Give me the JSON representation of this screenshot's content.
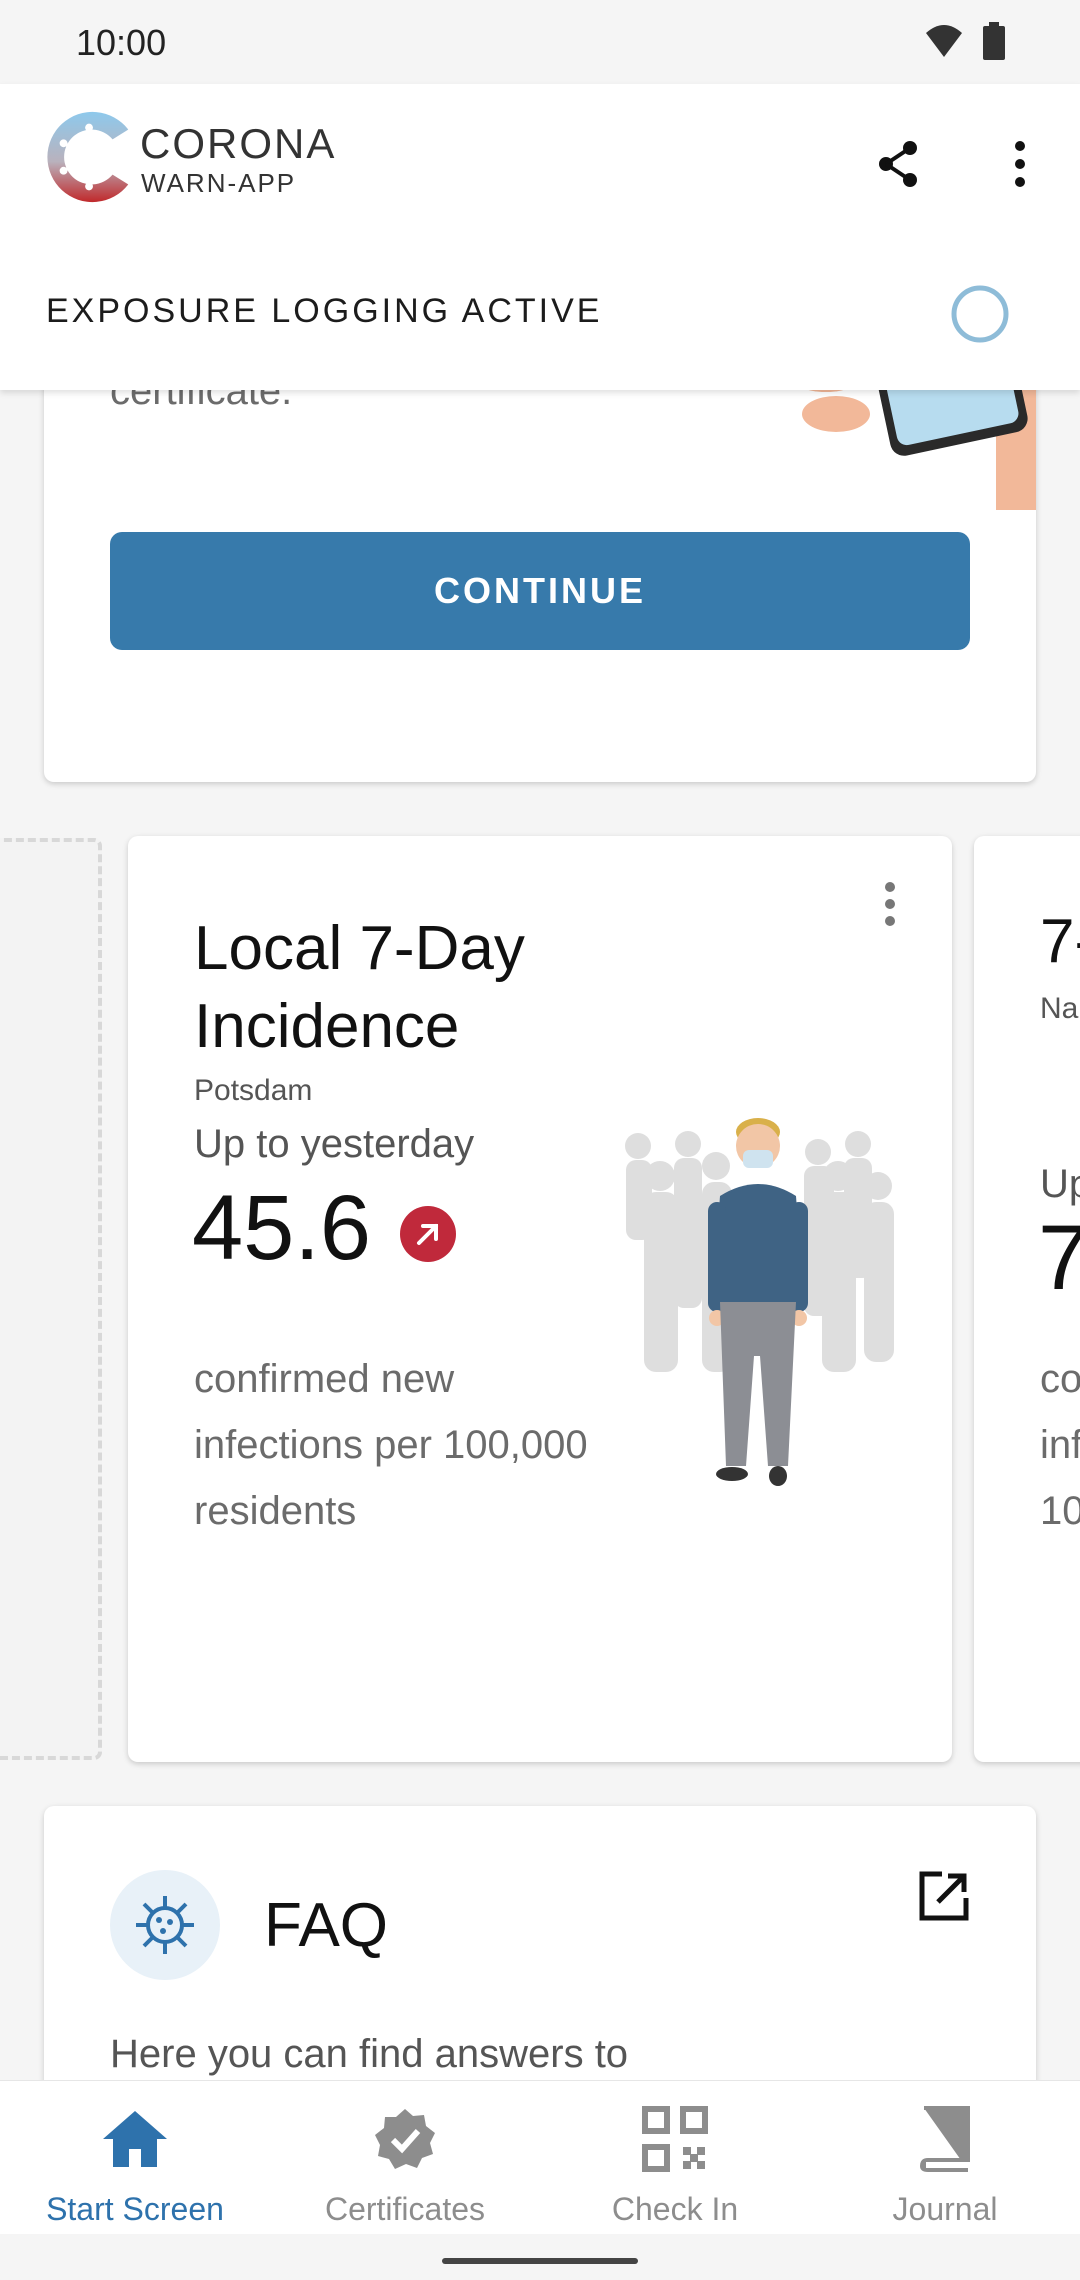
{
  "status_bar": {
    "time": "10:00"
  },
  "header": {
    "brand_name": "CORONA",
    "brand_sub": "WARN-APP",
    "exposure_status": "EXPOSURE LOGGING ACTIVE"
  },
  "certificate_card": {
    "text": "request your digital COVID test certificate.",
    "continue_label": "CONTINUE"
  },
  "incidence_card": {
    "title": "Local 7-Day Incidence",
    "location": "Potsdam",
    "period": "Up to yesterday",
    "value": "45.6",
    "trend": "rising",
    "description": "confirmed new infections per 100,000 residents"
  },
  "next_card": {
    "title_partial": "7-",
    "location_partial": "Na",
    "period_partial": "Up",
    "value_partial": "7",
    "desc_line1": "co",
    "desc_line2": "inf",
    "desc_line3": "10"
  },
  "faq_card": {
    "title": "FAQ",
    "text": "Here you can find answers to"
  },
  "bottom_nav": {
    "items": [
      {
        "label": "Start Screen",
        "icon": "home-icon",
        "active": true
      },
      {
        "label": "Certificates",
        "icon": "certificate-badge-icon",
        "active": false
      },
      {
        "label": "Check In",
        "icon": "qr-code-icon",
        "active": false
      },
      {
        "label": "Journal",
        "icon": "book-icon",
        "active": false
      }
    ]
  },
  "colors": {
    "accent": "#377aab",
    "active_nav": "#2e72ac",
    "trend_red": "#c0293b"
  }
}
